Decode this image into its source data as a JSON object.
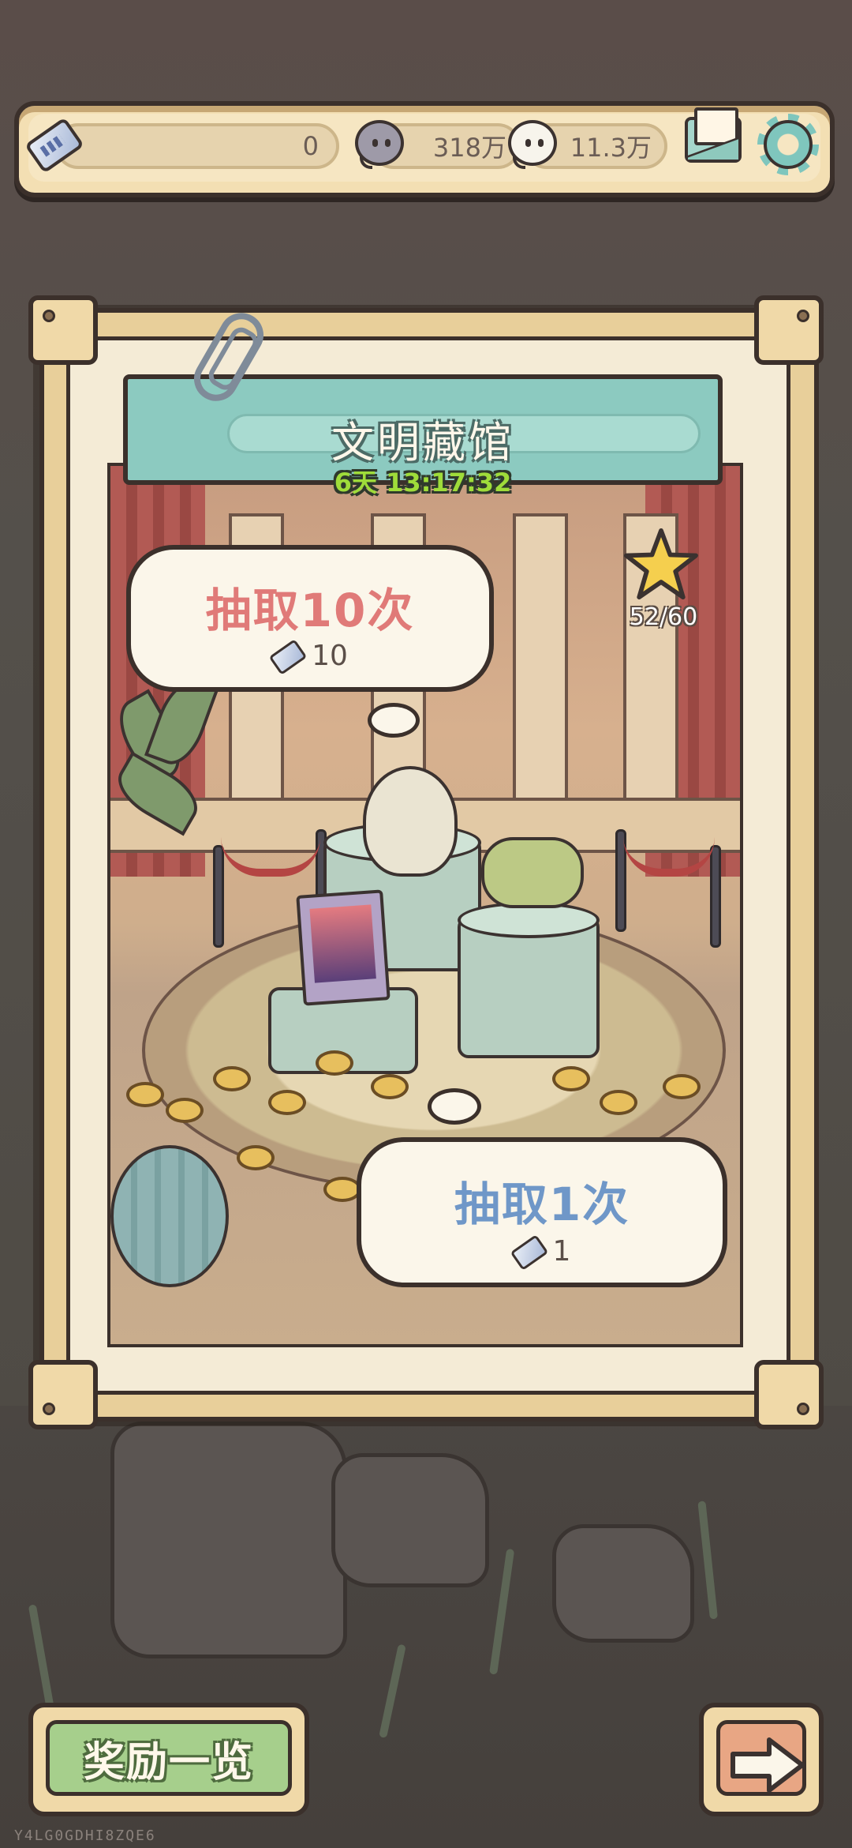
{
  "currency": {
    "tickets": "0",
    "grey_spirit": "318万",
    "white_spirit": "11.3万"
  },
  "event": {
    "title": "文明藏馆",
    "timer": "6天 13:17:32"
  },
  "draw_ten": {
    "label": "抽取10次",
    "cost": "10"
  },
  "draw_one": {
    "label": "抽取1次",
    "cost": "1"
  },
  "progress": {
    "stars": "52/60"
  },
  "footer": {
    "rewards_label": "奖励一览",
    "uid": "Y4LG0GDHI8ZQE6"
  },
  "colors": {
    "draw_ten_text": "#e07a78",
    "draw_one_text": "#6f97c8",
    "ribbon": "#8ccac0",
    "reward_button": "#a6cf8c",
    "next_button": "#e8a684"
  },
  "icons": [
    "ticket-icon",
    "grey-spirit-icon",
    "white-spirit-icon",
    "mail-icon",
    "gear-icon",
    "star-icon",
    "arrow-right-icon"
  ]
}
